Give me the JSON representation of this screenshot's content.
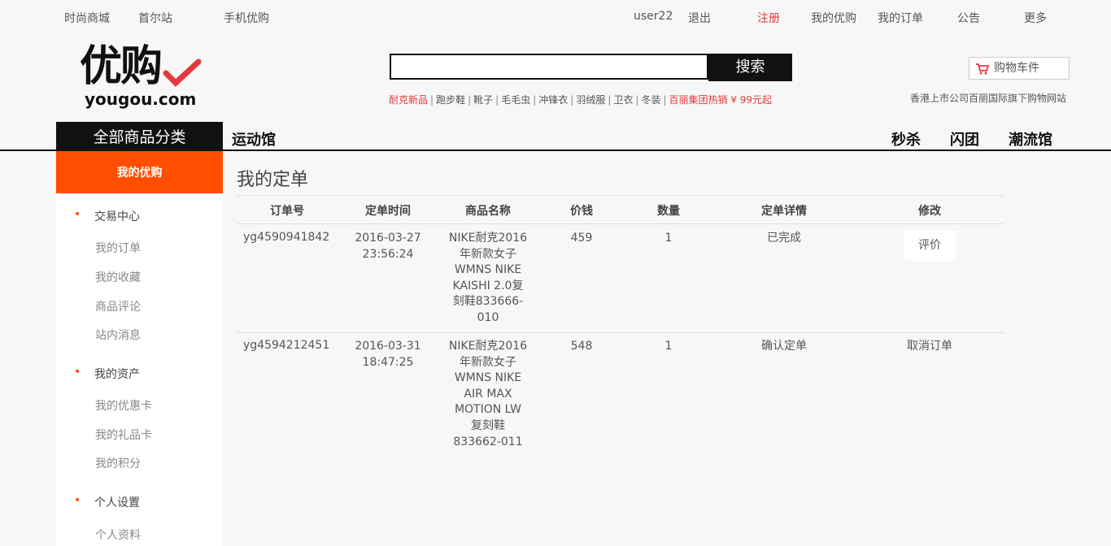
{
  "topbar": {
    "left": [
      "时尚商城",
      "首尔站",
      "手机优购"
    ],
    "user": "user22",
    "logout": "退出",
    "register": "注册",
    "my_yougou": "我的优购",
    "my_orders": "我的订单",
    "notice": "公告",
    "more": "更多"
  },
  "logo": {
    "cn": "优购",
    "en": "yougou.com"
  },
  "search": {
    "value": "",
    "button": "搜索"
  },
  "hot_keywords": [
    "耐克新品",
    "跑步鞋",
    "靴子",
    "毛毛虫",
    "冲锋衣",
    "羽绒服",
    "卫衣",
    "冬装",
    "百丽集团热销 ¥ 99元起"
  ],
  "cart": {
    "label": "购物车件"
  },
  "slogan": "香港上市公司百丽国际旗下购物网站",
  "nav": {
    "all_categories": "全部商品分类",
    "sports": "运动馆",
    "flash_sale": "秒杀",
    "group": "闪团",
    "trend": "潮流馆"
  },
  "sidebar": {
    "header": "我的优购",
    "trade_center": "交易中心",
    "my_orders": "我的订单",
    "my_favorites": "我的收藏",
    "reviews": "商品评论",
    "messages": "站内消息",
    "my_assets": "我的资产",
    "coupons": "我的优惠卡",
    "gift_cards": "我的礼品卡",
    "points": "我的积分",
    "settings": "个人设置",
    "profile": "个人资料"
  },
  "page_title": "我的定单",
  "table": {
    "headers": [
      "订单号",
      "定单时间",
      "商品名称",
      "价钱",
      "数量",
      "定单详情",
      "修改"
    ],
    "rows": [
      {
        "id": "yg4590941842",
        "date": "2016-03-27",
        "time": "23:56:24",
        "name_lines": [
          "NIKE耐克2016",
          "年新款女子",
          "WMNS NIKE",
          "KAISHI 2.0复",
          "刻鞋833666-",
          "010"
        ],
        "price": "459",
        "qty": "1",
        "status": "已完成",
        "action": "评价"
      },
      {
        "id": "yg4594212451",
        "date": "2016-03-31",
        "time": "18:47:25",
        "name_lines": [
          "NIKE耐克2016",
          "年新款女子",
          "WMNS NIKE",
          "AIR MAX",
          "MOTION LW",
          "复刻鞋",
          "833662-011"
        ],
        "price": "548",
        "qty": "1",
        "status": "确认定单",
        "action": "取消订单"
      }
    ]
  },
  "colors": {
    "accent": "#ff4e00",
    "red": "#e4393c",
    "dark": "#111111"
  }
}
